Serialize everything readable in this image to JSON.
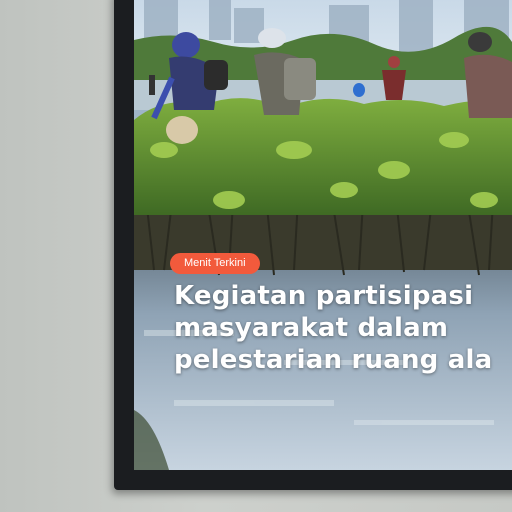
{
  "news_card": {
    "badge_label": "Menit Terkini",
    "headline_lines": [
      "Kegiatan partisipasi",
      "masyarakat dalam",
      "pelestarian ruang ala"
    ]
  },
  "colors": {
    "badge": "#f25a3c",
    "bezel": "#1b1d20",
    "wall": "#c9ccc8"
  }
}
